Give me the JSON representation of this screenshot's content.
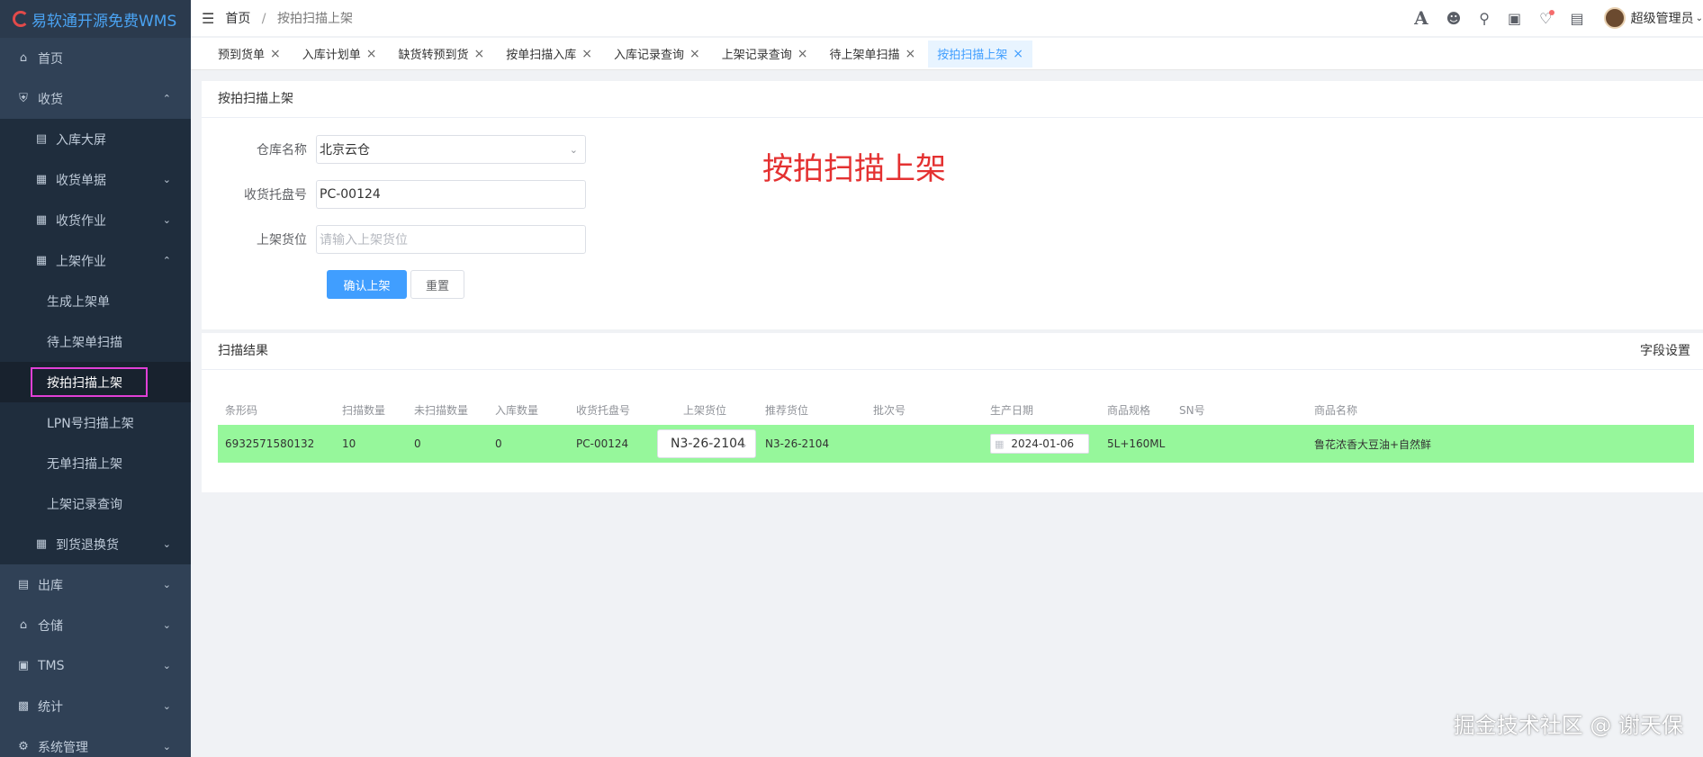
{
  "app": {
    "logo_text": "易软通开源免费WMS"
  },
  "sidebar": {
    "items": [
      {
        "label": "首页",
        "icon": "home-icon"
      },
      {
        "label": "收货",
        "icon": "receive-icon",
        "expanded": true
      },
      {
        "label": "入库大屏",
        "icon": "monitor-icon"
      },
      {
        "label": "收货单据",
        "icon": "grid-icon",
        "expanded": false
      },
      {
        "label": "收货作业",
        "icon": "grid-icon",
        "expanded": false
      },
      {
        "label": "上架作业",
        "icon": "grid-icon",
        "expanded": true
      },
      {
        "label": "生成上架单"
      },
      {
        "label": "待上架单扫描"
      },
      {
        "label": "按拍扫描上架",
        "active": true
      },
      {
        "label": "LPN号扫描上架"
      },
      {
        "label": "无单扫描上架"
      },
      {
        "label": "上架记录查询"
      },
      {
        "label": "到货退换货",
        "icon": "grid-icon",
        "expanded": false
      },
      {
        "label": "出库",
        "icon": "outbound-icon",
        "expanded": false
      },
      {
        "label": "仓储",
        "icon": "warehouse-icon",
        "expanded": false
      },
      {
        "label": "TMS",
        "icon": "truck-icon",
        "expanded": false
      },
      {
        "label": "统计",
        "icon": "stats-icon",
        "expanded": false
      },
      {
        "label": "系统管理",
        "icon": "settings-icon",
        "expanded": false
      }
    ]
  },
  "header": {
    "breadcrumb": [
      "首页",
      "按拍扫描上架"
    ],
    "user_name": "超级管理员"
  },
  "tabs": [
    {
      "label": "预到货单"
    },
    {
      "label": "入库计划单"
    },
    {
      "label": "缺货转预到货"
    },
    {
      "label": "按单扫描入库"
    },
    {
      "label": "入库记录查询"
    },
    {
      "label": "上架记录查询"
    },
    {
      "label": "待上架单扫描"
    },
    {
      "label": "按拍扫描上架",
      "active": true
    }
  ],
  "form": {
    "title": "按拍扫描上架",
    "big_title": "按拍扫描上架",
    "warehouse_label": "仓库名称",
    "warehouse_value": "北京云仓",
    "pallet_label": "收货托盘号",
    "pallet_value": "PC-00124",
    "location_label": "上架货位",
    "location_placeholder": "请输入上架货位",
    "confirm_button": "确认上架",
    "reset_button": "重置"
  },
  "results": {
    "title": "扫描结果",
    "field_settings": "字段设置",
    "columns": [
      "条形码",
      "扫描数量",
      "未扫描数量",
      "入库数量",
      "收货托盘号",
      "上架货位",
      "推荐货位",
      "批次号",
      "生产日期",
      "商品规格",
      "SN号",
      "商品名称"
    ],
    "rows": [
      {
        "barcode": "6932571580132",
        "scanned_qty": "10",
        "unscanned_qty": "0",
        "inbound_qty": "0",
        "pallet": "PC-00124",
        "location": "N3-26-2104",
        "recommended": "N3-26-2104",
        "batch": "",
        "production_date": "2024-01-06",
        "spec": "5L+160ML",
        "sn": "",
        "product_name": "鲁花浓香大豆油+自然鲜"
      }
    ]
  },
  "colors": {
    "sidebar_bg": "#304156",
    "accent": "#409eff",
    "row_highlight": "#96f79b",
    "title_red": "#e43131",
    "active_outline": "#e040d6"
  },
  "watermark": "掘金技术社区 @ 谢天保"
}
